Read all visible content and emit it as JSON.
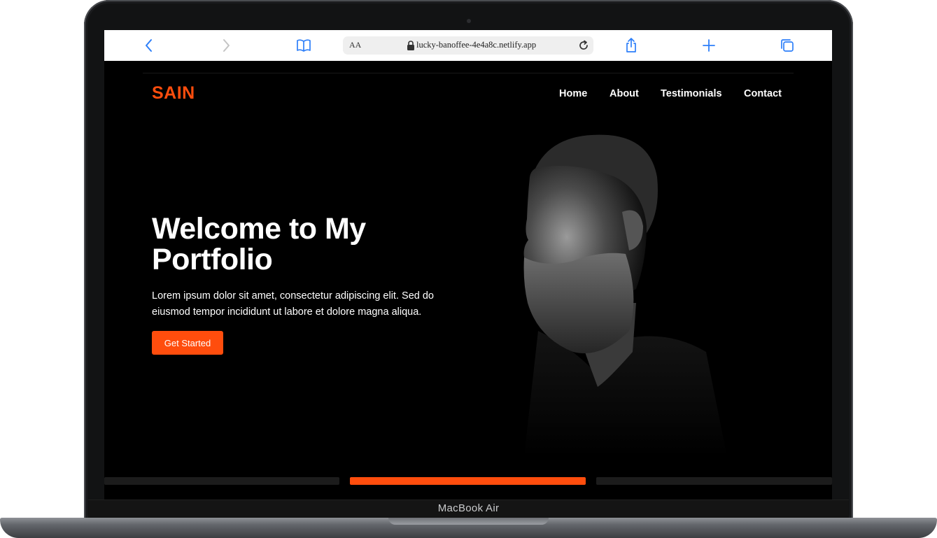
{
  "browser": {
    "text_size_label": "AA",
    "url": "lucky-banoffee-4e4a8c.netlify.app",
    "icons": {
      "back": "chevron-left-icon",
      "forward": "chevron-right-icon",
      "bookmarks": "book-icon",
      "reload": "reload-icon",
      "share": "share-icon",
      "new_tab": "plus-icon",
      "tabs": "tabs-icon"
    }
  },
  "site": {
    "logo": "SAIN",
    "nav": [
      "Home",
      "About",
      "Testimonials",
      "Contact"
    ]
  },
  "hero": {
    "title": "Welcome to My Portfolio",
    "description": "Lorem ipsum dolor sit amet, consectetur adipiscing elit. Sed do eiusmod tempor incididunt ut labore et dolore magna aliqua.",
    "cta": "Get Started"
  },
  "slider": {
    "slide_count": 3,
    "active_index": 1
  },
  "device": {
    "label": "MacBook Air"
  },
  "colors": {
    "accent": "#ff4d0d",
    "background": "#000000",
    "text": "#ffffff",
    "inactive_indicator": "#1c1c1c"
  }
}
